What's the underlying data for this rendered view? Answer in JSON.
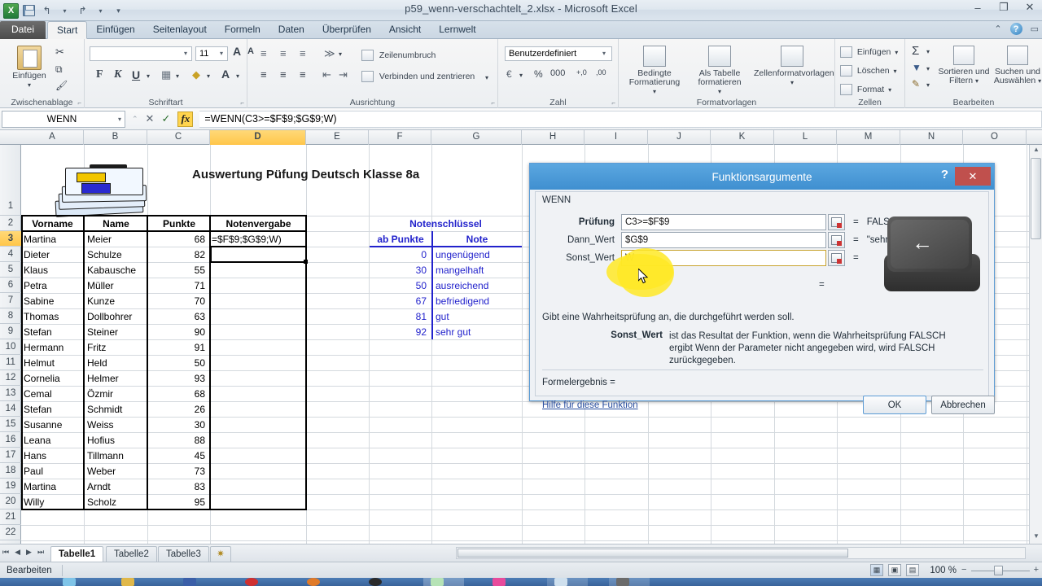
{
  "window": {
    "title": "p59_wenn-verschachtelt_2.xlsx  -  Microsoft Excel",
    "minimize": "–",
    "restore": "❐",
    "close": "✕"
  },
  "quick_access": {
    "app_logo": "X",
    "save": "save-icon",
    "undo": "↰",
    "redo": "↱",
    "customize": "▾"
  },
  "ribbon": {
    "tabs": [
      {
        "label": "Datei",
        "active": false,
        "file": true
      },
      {
        "label": "Start",
        "active": true,
        "file": false
      },
      {
        "label": "Einfügen",
        "active": false,
        "file": false
      },
      {
        "label": "Seitenlayout",
        "active": false,
        "file": false
      },
      {
        "label": "Formeln",
        "active": false,
        "file": false
      },
      {
        "label": "Daten",
        "active": false,
        "file": false
      },
      {
        "label": "Überprüfen",
        "active": false,
        "file": false
      },
      {
        "label": "Ansicht",
        "active": false,
        "file": false
      },
      {
        "label": "Lernwelt",
        "active": false,
        "file": false
      }
    ],
    "help_icons": {
      "collapse": "⌃",
      "help": "?",
      "minimize_ribbon": "▭"
    },
    "groups": [
      {
        "name": "Zwischenablage",
        "dialog_launcher": "⌐"
      },
      {
        "name": "Schriftart",
        "dialog_launcher": "⌐"
      },
      {
        "name": "Ausrichtung",
        "dialog_launcher": "⌐"
      },
      {
        "name": "Zahl",
        "dialog_launcher": "⌐"
      },
      {
        "name": "Formatvorlagen",
        "dialog_launcher": ""
      },
      {
        "name": "Zellen",
        "dialog_launcher": ""
      },
      {
        "name": "Bearbeiten",
        "dialog_launcher": ""
      }
    ],
    "clipboard": {
      "paste": "Einfügen",
      "cut": "✂",
      "copy": "⧉",
      "format_painter": "🖌"
    },
    "font": {
      "font_name": "",
      "font_size": "11",
      "grow": "A",
      "shrink": "A",
      "bold": "F",
      "italic": "K",
      "underline": "U",
      "borders": "▦",
      "fill": "◆",
      "color": "A"
    },
    "alignment": {
      "wrap_text": "Zeilenumbruch",
      "merge_center": "Verbinden und zentrieren",
      "orientation": "≫"
    },
    "number": {
      "format": "Benutzerdefiniert",
      "currency": "€",
      "percent": "%",
      "thousands": "000",
      "inc_dec": "+,0",
      "dec_dec": ",00"
    },
    "styles": {
      "conditional": "Bedingte Formatierung",
      "as_table": "Als Tabelle formatieren",
      "cell_styles": "Zellenformatvorlagen"
    },
    "cells": {
      "insert": "Einfügen",
      "delete": "Löschen",
      "format": "Format"
    },
    "editing": {
      "autosum": "Σ",
      "fill": "▼",
      "clear": "✎",
      "sort_filter": "Sortieren und Filtern",
      "find_select": "Suchen und Auswählen"
    }
  },
  "formula_bar": {
    "name_box": "WENN",
    "name_box_arrow": "▾",
    "cancel": "✕",
    "accept": "✓",
    "insert_function": "fx",
    "content": "=WENN(C3>=$F$9;$G$9;W)"
  },
  "grid": {
    "columns": [
      "A",
      "B",
      "C",
      "D",
      "E",
      "F",
      "G",
      "H",
      "I",
      "J",
      "K",
      "L",
      "M",
      "N",
      "O"
    ],
    "selected_column": "D",
    "rows": [
      "1",
      "2",
      "3",
      "4",
      "5",
      "6",
      "7",
      "8",
      "9",
      "10",
      "11",
      "12",
      "13",
      "14",
      "15",
      "16",
      "17",
      "18",
      "19",
      "20",
      "21",
      "22"
    ],
    "selected_row": "3",
    "sheet_title": "Auswertung Püfung Deutsch Klasse 8a",
    "headers": {
      "vorname": "Vorname",
      "name": "Name",
      "punkte": "Punkte",
      "notenvergabe": "Notenvergabe"
    },
    "students": [
      {
        "row": "3",
        "vorname": "Martina",
        "name": "Meier",
        "punkte": "68"
      },
      {
        "row": "4",
        "vorname": "Dieter",
        "name": "Schulze",
        "punkte": "82"
      },
      {
        "row": "5",
        "vorname": "Klaus",
        "name": "Kabausche",
        "punkte": "55"
      },
      {
        "row": "6",
        "vorname": "Petra",
        "name": "Müller",
        "punkte": "71"
      },
      {
        "row": "7",
        "vorname": "Sabine",
        "name": "Kunze",
        "punkte": "70"
      },
      {
        "row": "8",
        "vorname": "Thomas",
        "name": "Dollbohrer",
        "punkte": "63"
      },
      {
        "row": "9",
        "vorname": "Stefan",
        "name": "Steiner",
        "punkte": "90"
      },
      {
        "row": "10",
        "vorname": "Hermann",
        "name": "Fritz",
        "punkte": "91"
      },
      {
        "row": "11",
        "vorname": "Helmut",
        "name": "Held",
        "punkte": "50"
      },
      {
        "row": "12",
        "vorname": "Cornelia",
        "name": "Helmer",
        "punkte": "93"
      },
      {
        "row": "13",
        "vorname": "Cemal",
        "name": "Özmir",
        "punkte": "68"
      },
      {
        "row": "14",
        "vorname": "Stefan",
        "name": "Schmidt",
        "punkte": "26"
      },
      {
        "row": "15",
        "vorname": "Susanne",
        "name": "Weiss",
        "punkte": "30"
      },
      {
        "row": "16",
        "vorname": "Leana",
        "name": "Hofius",
        "punkte": "88"
      },
      {
        "row": "17",
        "vorname": "Hans",
        "name": "Tillmann",
        "punkte": "45"
      },
      {
        "row": "18",
        "vorname": "Paul",
        "name": "Weber",
        "punkte": "73"
      },
      {
        "row": "19",
        "vorname": "Martina",
        "name": "Arndt",
        "punkte": "83"
      },
      {
        "row": "20",
        "vorname": "Willy",
        "name": "Scholz",
        "punkte": "95"
      }
    ],
    "grade_key": {
      "title": "Notenschlüssel",
      "col_points": "ab Punkte",
      "col_grade": "Note",
      "entries": [
        {
          "points": "0",
          "grade": "ungenügend"
        },
        {
          "points": "30",
          "grade": "mangelhaft"
        },
        {
          "points": "50",
          "grade": "ausreichend"
        },
        {
          "points": "67",
          "grade": "befriedigend"
        },
        {
          "points": "81",
          "grade": "gut"
        },
        {
          "points": "92",
          "grade": "sehr gut"
        }
      ]
    },
    "edit_cell": {
      "address": "D3",
      "visible_text": "=$F$9;$G$9;W)"
    }
  },
  "dialog": {
    "title": "Funktionsargumente",
    "help_button": "?",
    "close_button": "✕",
    "function_name": "WENN",
    "args": [
      {
        "label": "Prüfung",
        "value": "C3>=$F$9",
        "equals": "=",
        "result": "FALSCH",
        "bold": true
      },
      {
        "label": "Dann_Wert",
        "value": "$G$9",
        "equals": "=",
        "result": "\"sehr gut\"",
        "bold": false
      },
      {
        "label": "Sonst_Wert",
        "value": "W",
        "equals": "=",
        "result": "",
        "bold": false
      }
    ],
    "extra_equals": "=",
    "description_general": "Gibt eine Wahrheitsprüfung an, die durchgeführt werden soll.",
    "param_name": "Sonst_Wert",
    "param_description": "ist das Resultat der Funktion, wenn die Wahrheitsprüfung FALSCH ergibt Wenn der Parameter nicht angegeben wird, wird FALSCH zurückgegeben.",
    "formula_result_label": "Formelergebnis =",
    "help_link": "Hilfe für diese Funktion",
    "ok_button": "OK",
    "cancel_button": "Abbrechen",
    "image": "backspace-key-image",
    "key_glyph": "←"
  },
  "sheet_tabs": {
    "nav": [
      "⏮",
      "◀",
      "▶",
      "⏭"
    ],
    "tabs": [
      {
        "label": "Tabelle1",
        "active": true
      },
      {
        "label": "Tabelle2",
        "active": false
      },
      {
        "label": "Tabelle3",
        "active": false
      }
    ],
    "new_sheet": "✷"
  },
  "status_bar": {
    "mode": "Bearbeiten",
    "view_normal": "▦",
    "view_layout": "▣",
    "view_break": "▤",
    "zoom": "100 %",
    "zoom_out": "−",
    "zoom_in": "+"
  },
  "taskbar": {
    "items": [
      "browser-icon",
      "explorer-icon",
      "folder-icon",
      "recorder-icon",
      "firefox-icon",
      "pirate-icon",
      "excel-icon",
      "magix-icon",
      "window-icon",
      "camera-icon"
    ]
  },
  "colors": {
    "accent_blue": "#3f8fd0",
    "selection_orange": "#ffc64a",
    "grade_blue": "#2222cc",
    "highlight_yellow": "#ffe926",
    "close_red": "#c0504d"
  }
}
